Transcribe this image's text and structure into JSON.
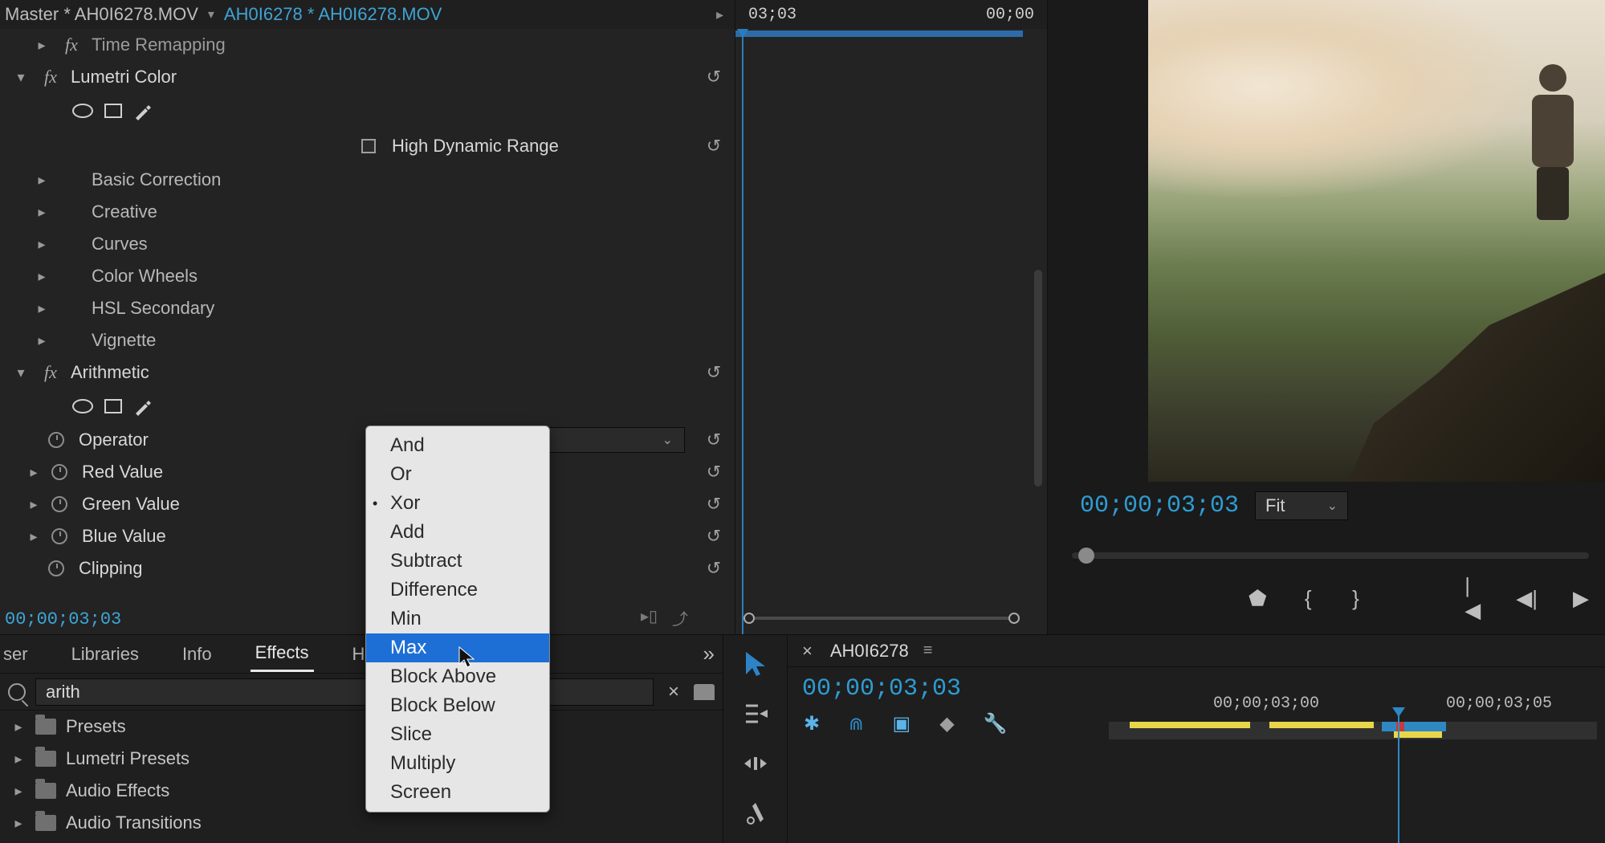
{
  "effect_controls": {
    "header": {
      "master_label": "Master * AH0I6278.MOV",
      "caret": "▾",
      "clip_label": "AH0I6278 * AH0I6278.MOV",
      "tri": "▸"
    },
    "rows": {
      "time_remapping": "Time Remapping",
      "lumetri": "Lumetri Color",
      "pen_title": "pen",
      "hdr_label": "High Dynamic Range",
      "basic": "Basic Correction",
      "creative": "Creative",
      "curves": "Curves",
      "color_wheels": "Color Wheels",
      "hsl": "HSL Secondary",
      "vignette": "Vignette",
      "arithmetic": "Arithmetic",
      "operator_label": "Operator",
      "operator_value": "Xor",
      "red_value": "Red Value",
      "green_value": "Green Value",
      "blue_value": "Blue Value",
      "clipping": "Clipping"
    },
    "reset_glyph": "↺",
    "timecode": "00;00;03;03"
  },
  "graph": {
    "header_left": "03;03",
    "header_right": "00;00"
  },
  "preview": {
    "timecode": "00;00;03;03",
    "fit_label": "Fit",
    "buttons": {
      "mark_in": "⬟",
      "bracket_open": "{",
      "bracket_close": "}",
      "goto_in": "|◀",
      "step_back": "◀|",
      "play": "▶"
    }
  },
  "bottom_tabs": {
    "ser": "ser",
    "libraries": "Libraries",
    "info": "Info",
    "effects": "Effects",
    "history": "History",
    "overflow": "»"
  },
  "search": {
    "value": "arith",
    "clear": "×"
  },
  "effects_tree": {
    "presets": "Presets",
    "lumetri_presets": "Lumetri Presets",
    "audio_effects": "Audio Effects",
    "audio_transitions": "Audio Transitions"
  },
  "timeline": {
    "close": "×",
    "name": "AH0I6278",
    "menu": "≡",
    "timecode": "00;00;03;03",
    "ruler": {
      "t1": "00;00;03;00",
      "t2": "00;00;03;05"
    },
    "tools": {
      "selection": "selection",
      "track_select": "track-select",
      "ripple": "ripple",
      "rate": "rate-stretch",
      "razor": "razor"
    }
  },
  "popup": {
    "options": [
      "And",
      "Or",
      "Xor",
      "Add",
      "Subtract",
      "Difference",
      "Min",
      "Max",
      "Block Above",
      "Block Below",
      "Slice",
      "Multiply",
      "Screen"
    ],
    "selected": "Xor",
    "highlighted": "Max"
  }
}
